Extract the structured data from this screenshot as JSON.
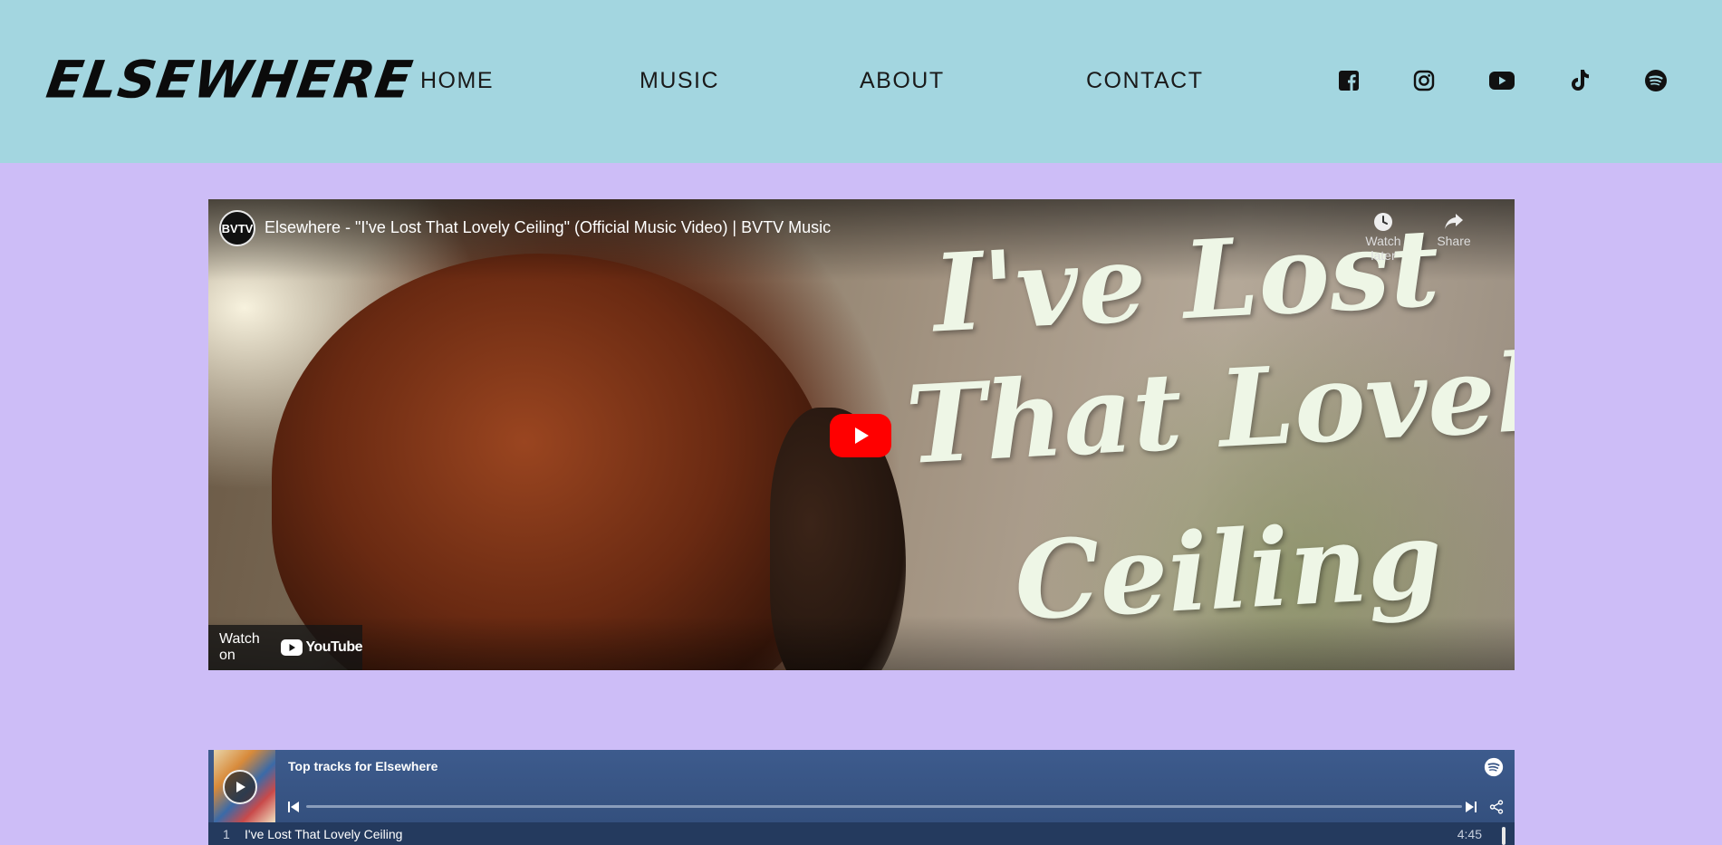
{
  "header": {
    "logo": "ELSEWHERE",
    "nav": [
      "HOME",
      "MUSIC",
      "ABOUT",
      "CONTACT"
    ],
    "social_icons": [
      "facebook-icon",
      "instagram-icon",
      "youtube-icon",
      "tiktok-icon",
      "spotify-icon"
    ]
  },
  "video": {
    "channel_avatar": "BVTV",
    "title": "Elsewhere - \"I've Lost That Lovely Ceiling\" (Official Music Video) | BVTV Music",
    "watch_later_label": "Watch later",
    "share_label": "Share",
    "overlay_line1": "I've Lost",
    "overlay_line2": "That Lovely",
    "overlay_line3": "Ceiling",
    "watch_on_label": "Watch on",
    "youtube_label": "YouTube"
  },
  "spotify": {
    "title": "Top tracks for Elsewhere",
    "tracks": [
      {
        "number": "1",
        "name": "I've Lost That Lovely Ceiling",
        "duration": "4:45"
      }
    ]
  },
  "colors": {
    "header_bg": "#a3d6e0",
    "page_bg": "#cdbdf7",
    "spotify_bg": "#385687",
    "youtube_red": "#ff0000"
  }
}
